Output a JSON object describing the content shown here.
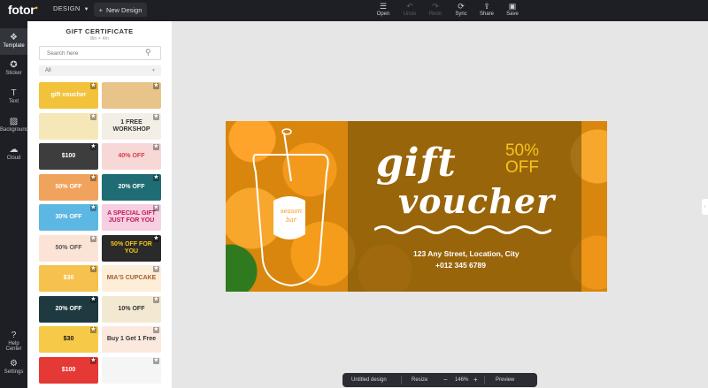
{
  "app": {
    "logo": "fotor",
    "mode_label": "DESIGN",
    "new_design_label": "New Design"
  },
  "toolbar": {
    "open_label": "Open",
    "undo_label": "Undo",
    "redo_label": "Redo",
    "sync_label": "Sync",
    "share_label": "Share",
    "save_label": "Save"
  },
  "rail": {
    "template_label": "Template",
    "sticker_label": "Sticker",
    "text_label": "Text",
    "background_label": "Background",
    "cloud_label": "Cloud",
    "help_label": "Help Center",
    "settings_label": "Settings"
  },
  "panel": {
    "title": "GIFT CERTIFICATE",
    "subtitle": "8in × 4in",
    "search_placeholder": "Search here",
    "filter_value": "All",
    "thumbnails": [
      {
        "text": "gift voucher",
        "bg": "#f2c23b",
        "fg": "#ffffff"
      },
      {
        "text": "",
        "bg": "#e9c48a",
        "fg": "#ffffff"
      },
      {
        "text": "",
        "bg": "#f6e7b8",
        "fg": "#e07b54"
      },
      {
        "text": "1 FREE WORKSHOP",
        "bg": "#f3efe6",
        "fg": "#333333"
      },
      {
        "text": "$100",
        "bg": "#3d3d3d",
        "fg": "#ffffff"
      },
      {
        "text": "40% OFF",
        "bg": "#f8d7d7",
        "fg": "#d9414b"
      },
      {
        "text": "50% OFF",
        "bg": "#f0a35c",
        "fg": "#ffffff"
      },
      {
        "text": "20% OFF",
        "bg": "#1f6c74",
        "fg": "#ffffff"
      },
      {
        "text": "30% OFF",
        "bg": "#5db7e3",
        "fg": "#ffffff"
      },
      {
        "text": "A SPECIAL GIFT JUST FOR YOU",
        "bg": "#f6cfe1",
        "fg": "#c2185b"
      },
      {
        "text": "50% OFF",
        "bg": "#fbe3d6",
        "fg": "#555555"
      },
      {
        "text": "50% OFF FOR YOU",
        "bg": "#2a2a2a",
        "fg": "#f5c518"
      },
      {
        "text": "$30",
        "bg": "#f6c14d",
        "fg": "#ffffff"
      },
      {
        "text": "MIA'S CUPCAKE",
        "bg": "#fdeed9",
        "fg": "#a35d2f"
      },
      {
        "text": "20% OFF",
        "bg": "#1e3a40",
        "fg": "#ffffff"
      },
      {
        "text": "10% OFF",
        "bg": "#f3e9d2",
        "fg": "#333333"
      },
      {
        "text": "$30",
        "bg": "#f7c948",
        "fg": "#111111"
      },
      {
        "text": "Buy 1 Get 1 Free",
        "bg": "#fbe9de",
        "fg": "#333333"
      },
      {
        "text": "$100",
        "bg": "#e53935",
        "fg": "#ffffff"
      },
      {
        "text": "",
        "bg": "#f5f5f5",
        "fg": "#333333"
      }
    ]
  },
  "card": {
    "jar_text": "season bar",
    "gift_text": "gift",
    "voucher_text": "voucher",
    "discount_line1": "50%",
    "discount_line2": "OFF",
    "address": "123 Any Street, Location, City",
    "phone": "+012 345 6789"
  },
  "bottom": {
    "doc_name": "Untitled design",
    "resize_label": "Resize",
    "zoom_minus": "−",
    "zoom_value": "146%",
    "zoom_plus": "+",
    "preview_label": "Preview"
  }
}
